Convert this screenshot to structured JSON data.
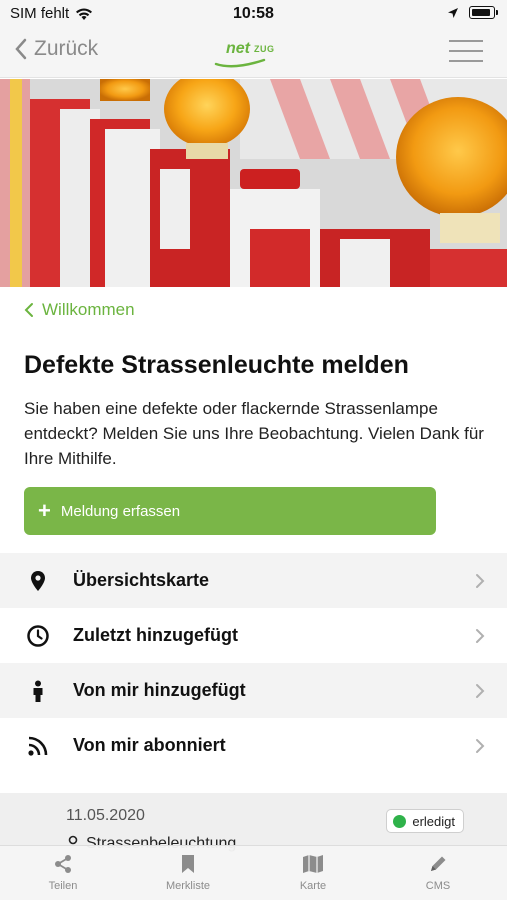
{
  "status_bar": {
    "carrier": "SIM fehlt",
    "time": "10:58"
  },
  "nav": {
    "back_label": "Zurück",
    "logo_primary": "net",
    "logo_secondary": "ZUG"
  },
  "breadcrumb": {
    "label": "Willkommen"
  },
  "page": {
    "title": "Defekte Strassenleuchte melden",
    "lead": "Sie haben eine defekte oder flackernde Strassenlampe entdeckt? Melden Sie uns Ihre Beobachtung. Vielen Dank für Ihre Mithilfe.",
    "cta_label": "Meldung erfassen"
  },
  "menu": {
    "items": [
      {
        "label": "Übersichtskarte",
        "icon": "map-pin-icon"
      },
      {
        "label": "Zuletzt hinzugefügt",
        "icon": "clock-icon"
      },
      {
        "label": "Von mir hinzugefügt",
        "icon": "person-icon"
      },
      {
        "label": "Von mir abonniert",
        "icon": "rss-icon"
      }
    ]
  },
  "report_card": {
    "date": "11.05.2020",
    "category": "Strassenbeleuchtung",
    "status": "erledigt",
    "status_color": "#2fb24a"
  },
  "tabbar": {
    "items": [
      {
        "label": "Teilen",
        "icon": "share-icon"
      },
      {
        "label": "Merkliste",
        "icon": "bookmark-icon"
      },
      {
        "label": "Karte",
        "icon": "map-icon"
      },
      {
        "label": "CMS",
        "icon": "pencil-icon"
      }
    ]
  },
  "colors": {
    "accent": "#6bb43f",
    "button": "#7ab648"
  }
}
